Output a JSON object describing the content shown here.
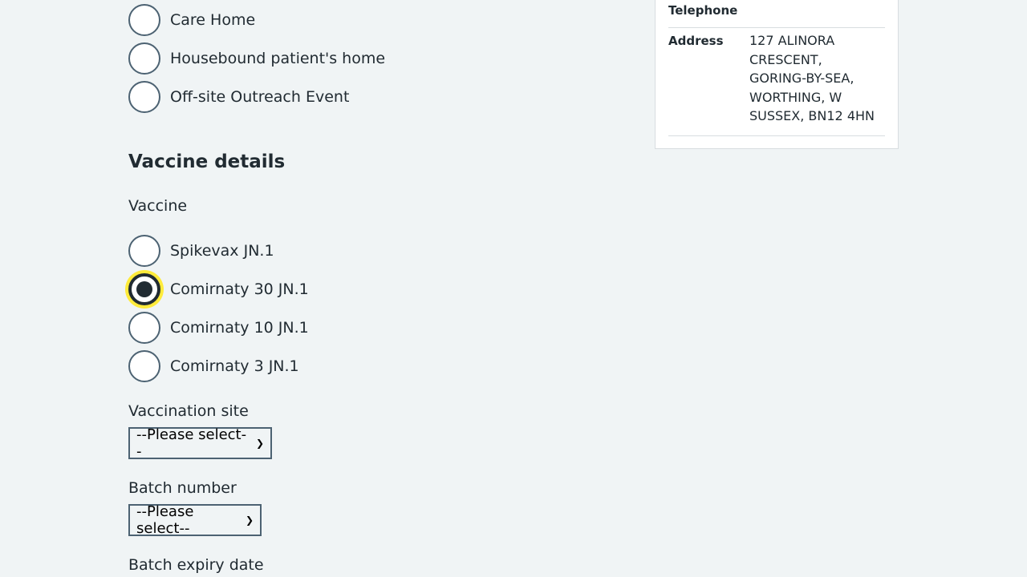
{
  "location_options": [
    {
      "label": "Care Home",
      "checked": false
    },
    {
      "label": "Housebound patient's home",
      "checked": false
    },
    {
      "label": "Off-site Outreach Event",
      "checked": false
    }
  ],
  "vaccine_details": {
    "heading": "Vaccine details",
    "vaccine_label": "Vaccine",
    "vaccine_options": [
      {
        "label": "Spikevax JN.1",
        "checked": false
      },
      {
        "label": "Comirnaty 30 JN.1",
        "checked": true
      },
      {
        "label": "Comirnaty 10 JN.1",
        "checked": false
      },
      {
        "label": "Comirnaty 3 JN.1",
        "checked": false
      }
    ],
    "vaccination_site_label": "Vaccination site",
    "vaccination_site_value": "--Please select--",
    "batch_number_label": "Batch number",
    "batch_number_value": "--Please select--",
    "batch_expiry_label": "Batch expiry date"
  },
  "patient_card": {
    "telephone_key": "Telephone",
    "address_key": "Address",
    "address_value": "127 ALINORA CRESCENT, GORING-BY-SEA, WORTHING, W SUSSEX, BN12 4HN"
  },
  "colors": {
    "background": "#f0f4f5",
    "text": "#212b32",
    "border": "#4c6272",
    "focus": "#ffeb3b"
  }
}
